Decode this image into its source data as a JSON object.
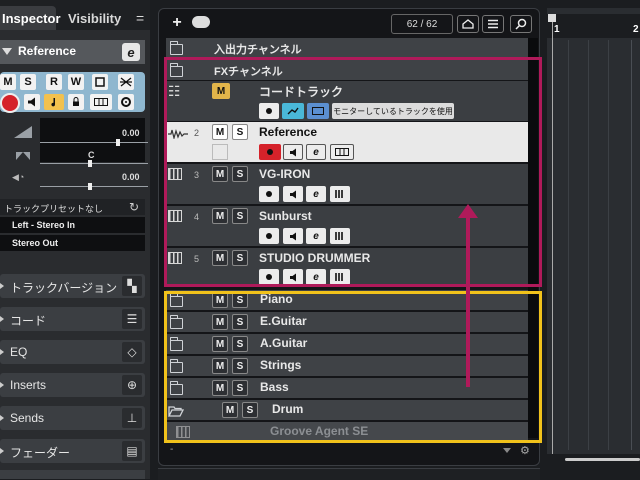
{
  "inspector": {
    "tab_inspector": "Inspector",
    "tab_visibility": "Visibility",
    "menu_glyph": "=",
    "track_name": "Reference",
    "edit_glyph": "e",
    "btn_m": "M",
    "btn_s": "S",
    "btn_r": "R",
    "btn_w": "W",
    "vol_value": "0.00",
    "pan_value": "C",
    "delay_value": "0.00",
    "preset": "トラックプリセットなし",
    "input_routing": "Left - Stereo In",
    "output_routing": "Stereo Out",
    "sections": [
      "トラックバージョン",
      "コード",
      "EQ",
      "Inserts",
      "Sends",
      "フェーダー"
    ]
  },
  "toolbar": {
    "add": "+",
    "counter": "62 / 62"
  },
  "tracks": {
    "io": {
      "name": "入出力チャンネル"
    },
    "fx": {
      "name": "FXチャンネル"
    },
    "chord": {
      "name": "コードトラック",
      "m": "M",
      "monitor_label": "モニターしているトラックを使用"
    },
    "reference": {
      "number": "2",
      "name": "Reference",
      "m": "M",
      "s": "S",
      "e": "e"
    },
    "vgiron": {
      "number": "3",
      "name": "VG-IRON",
      "m": "M",
      "s": "S",
      "e": "e"
    },
    "sunburst": {
      "number": "4",
      "name": "Sunburst",
      "m": "M",
      "s": "S",
      "e": "e"
    },
    "drummer": {
      "number": "5",
      "name": "STUDIO DRUMMER",
      "m": "M",
      "s": "S",
      "e": "e"
    },
    "piano": {
      "name": "Piano",
      "m": "M",
      "s": "S"
    },
    "eguitar": {
      "name": "E.Guitar",
      "m": "M",
      "s": "S"
    },
    "aguitar": {
      "name": "A.Guitar",
      "m": "M",
      "s": "S"
    },
    "strings": {
      "name": "Strings",
      "m": "M",
      "s": "S"
    },
    "bass": {
      "name": "Bass",
      "m": "M",
      "s": "S"
    },
    "drum": {
      "name": "Drum",
      "m": "M",
      "s": "S"
    },
    "groove": {
      "name": "Groove Agent SE"
    }
  },
  "footer": {
    "dash": "-"
  },
  "ruler": {
    "bar1": "1",
    "bar2": "2"
  },
  "colors": {
    "annotation_red": "#b01a5a",
    "annotation_yellow": "#f1c21b",
    "selected_row": "#e9e9e9",
    "record": "#d5222a",
    "monitor_active": "#f2c14e"
  }
}
